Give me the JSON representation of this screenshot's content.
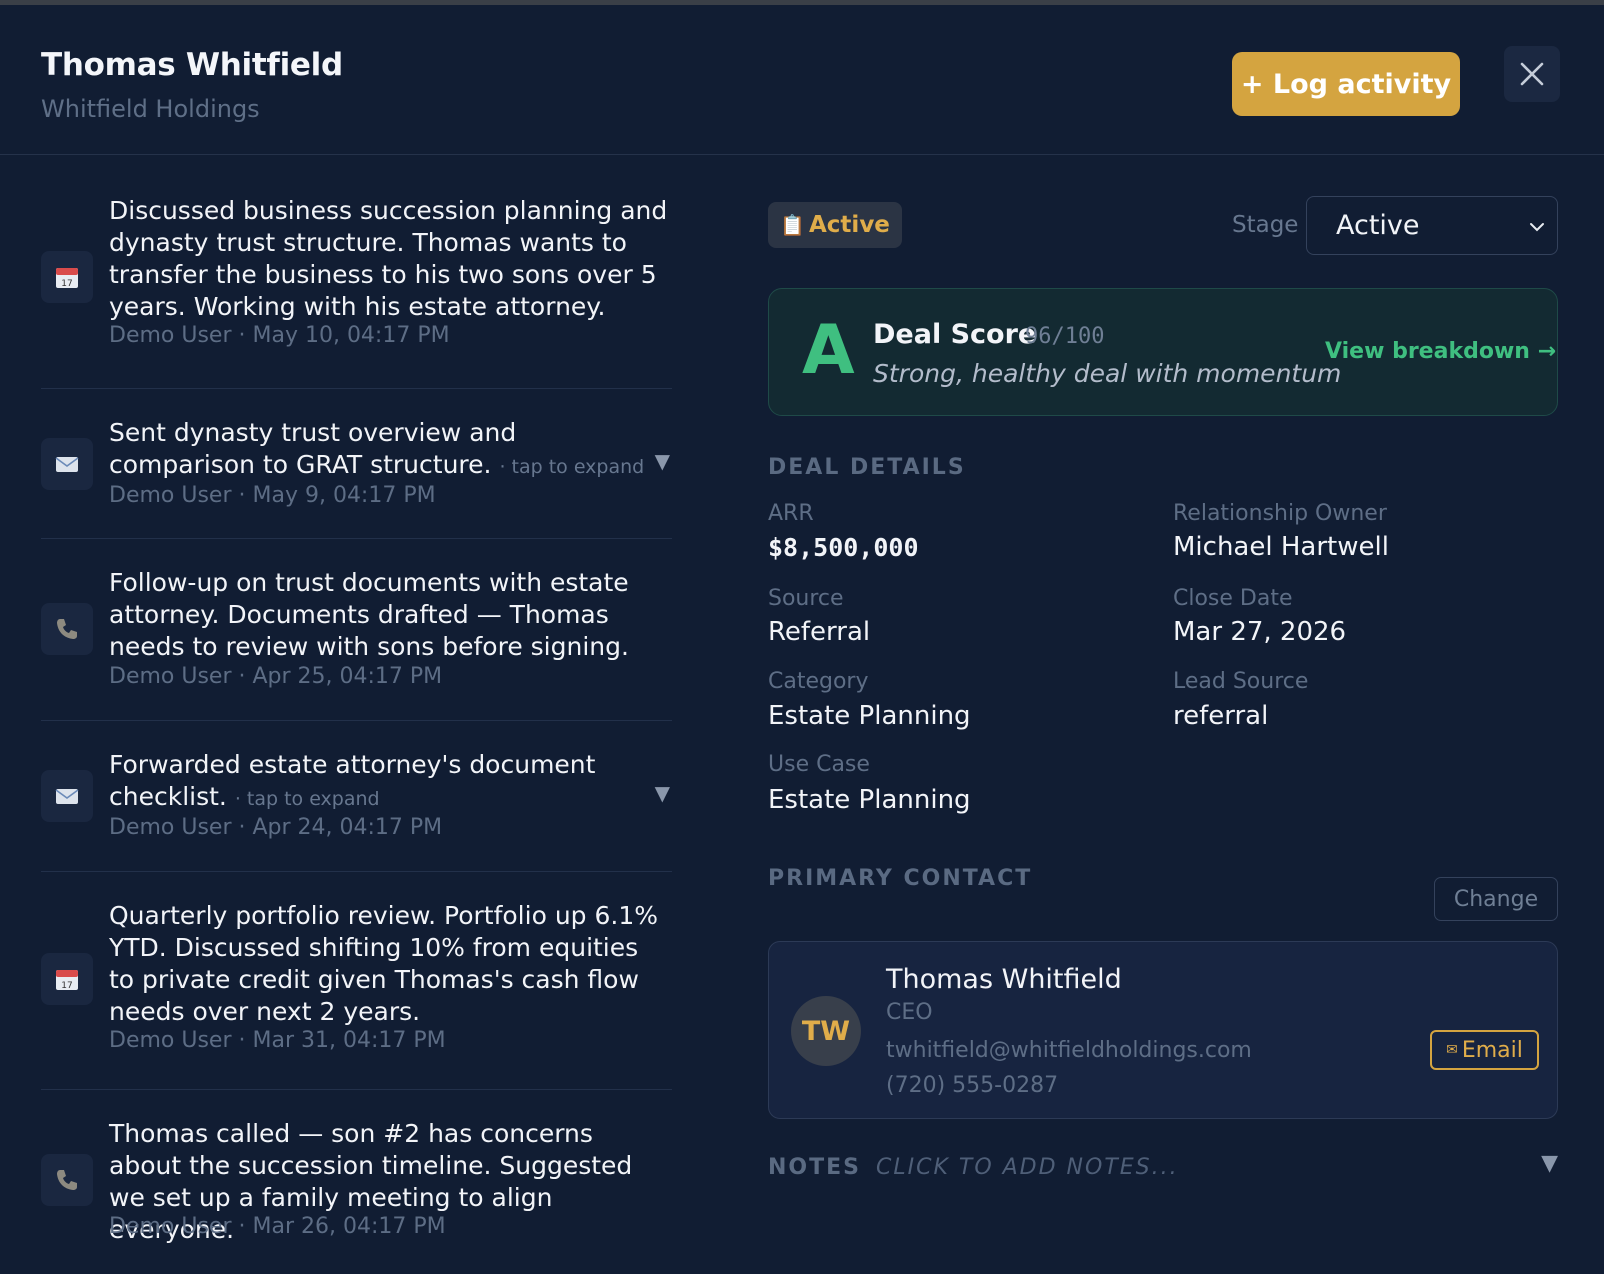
{
  "header": {
    "title": "Thomas Whitfield",
    "subtitle": "Whitfield Holdings",
    "log_activity_label": "+ Log activity"
  },
  "activities": [
    {
      "icon": "calendar-icon",
      "text": "Discussed business succession planning and dynasty trust structure. Thomas wants to transfer the business to his two sons over 5 years. Working with his estate attorney.",
      "meta": "Demo User · May 10, 04:17 PM",
      "hint": "",
      "caret": ""
    },
    {
      "icon": "mail-icon",
      "text": "Sent dynasty trust overview and comparison to GRAT structure.",
      "meta": "Demo User · May 9, 04:17 PM",
      "hint": "· tap to expand",
      "caret": "▼"
    },
    {
      "icon": "phone-icon",
      "text": "Follow-up on trust documents with estate attorney. Documents drafted — Thomas needs to review with sons before signing.",
      "meta": "Demo User · Apr 25, 04:17 PM",
      "hint": "",
      "caret": ""
    },
    {
      "icon": "mail-icon",
      "text": "Forwarded estate attorney's document checklist.",
      "meta": "Demo User · Apr 24, 04:17 PM",
      "hint": "· tap to expand",
      "caret": "▼"
    },
    {
      "icon": "calendar-icon",
      "text": "Quarterly portfolio review. Portfolio up 6.1% YTD. Discussed shifting 10% from equities to private credit given Thomas's cash flow needs over next 2 years.",
      "meta": "Demo User · Mar 31, 04:17 PM",
      "hint": "",
      "caret": ""
    },
    {
      "icon": "phone-icon",
      "text": "Thomas called — son #2 has concerns about the succession timeline. Suggested we set up a family meeting to align everyone.",
      "meta": "Demo User · Mar 26, 04:17 PM",
      "hint": "",
      "caret": ""
    }
  ],
  "status": {
    "emoji": "📋",
    "label": "Active"
  },
  "stage": {
    "label": "Stage",
    "value": "Active"
  },
  "deal_score": {
    "grade": "A",
    "title": "Deal Score",
    "score": "96/100",
    "description": "Strong, healthy deal with momentum",
    "link": "View breakdown →"
  },
  "deal_details": {
    "heading": "DEAL DETAILS",
    "arr_label": "ARR",
    "arr_value": "$8,500,000",
    "owner_label": "Relationship Owner",
    "owner_value": "Michael Hartwell",
    "source_label": "Source",
    "source_value": "Referral",
    "close_label": "Close Date",
    "close_value": "Mar 27, 2026",
    "category_label": "Category",
    "category_value": "Estate Planning",
    "lead_label": "Lead Source",
    "lead_value": "referral",
    "usecase_label": "Use Case",
    "usecase_value": "Estate Planning"
  },
  "primary_contact": {
    "heading": "PRIMARY CONTACT",
    "change_label": "Change",
    "initials": "TW",
    "name": "Thomas Whitfield",
    "role": "CEO",
    "email": "twhitfield@whitfieldholdings.com",
    "phone": "(720) 555-0287",
    "email_button": "Email",
    "email_glyph": "✉"
  },
  "notes": {
    "label": "NOTES",
    "placeholder": "CLICK TO ADD NOTES...",
    "caret": "▼"
  }
}
